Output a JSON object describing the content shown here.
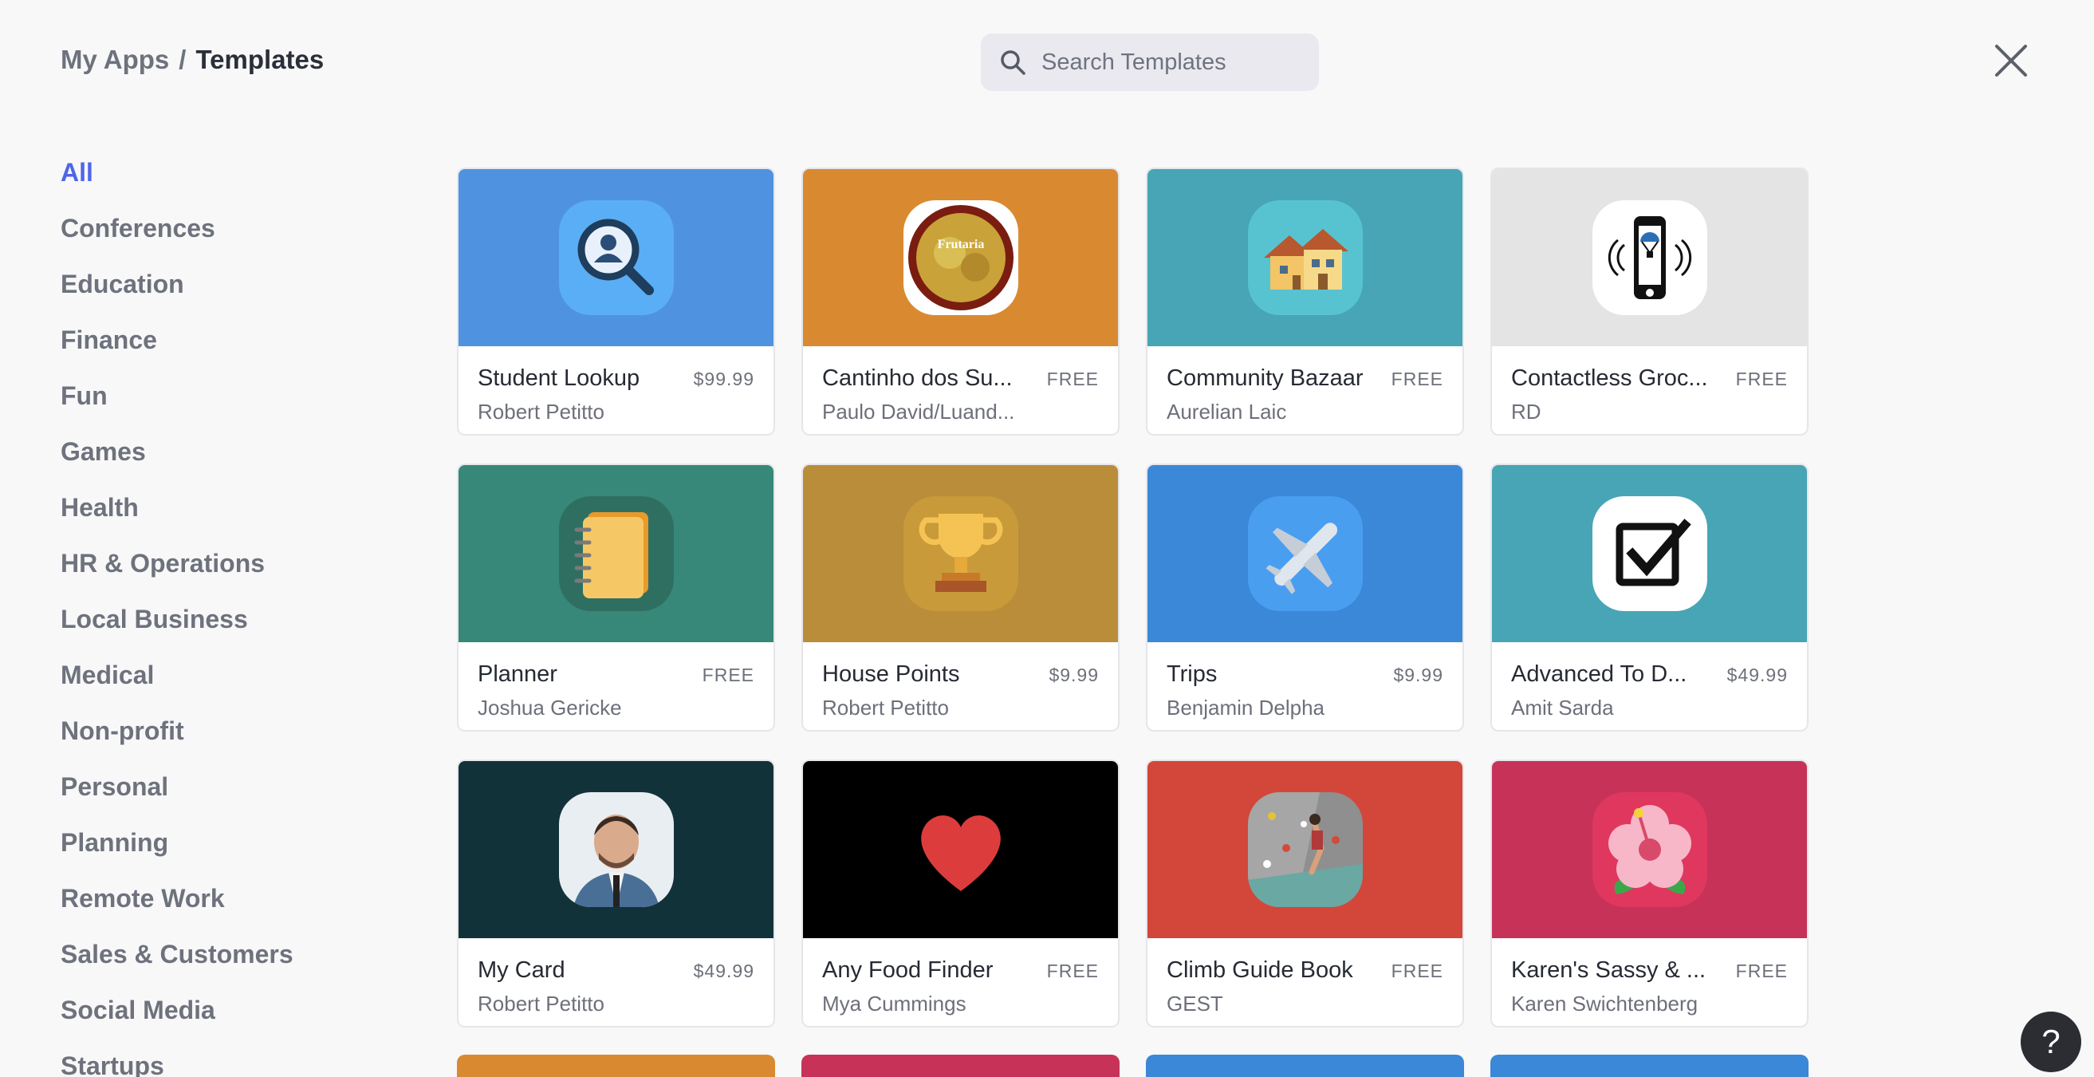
{
  "header": {
    "breadcrumb_parent": "My Apps",
    "breadcrumb_separator": "/",
    "breadcrumb_current": "Templates",
    "search_placeholder": "Search Templates"
  },
  "sidebar": {
    "active": "All",
    "categories": [
      "All",
      "Conferences",
      "Education",
      "Finance",
      "Fun",
      "Games",
      "Health",
      "HR & Operations",
      "Local Business",
      "Medical",
      "Non-profit",
      "Personal",
      "Planning",
      "Remote Work",
      "Sales & Customers",
      "Social Media",
      "Startups"
    ]
  },
  "templates": [
    {
      "title": "Student Lookup",
      "price": "$99.99",
      "author": "Robert Petitto",
      "bg": "#4f93e0",
      "icon": "student-search-icon"
    },
    {
      "title": "Cantinho dos Su...",
      "price": "FREE",
      "author": "Paulo David/Luand...",
      "bg": "#d98a31",
      "icon": "frutaria-logo-icon"
    },
    {
      "title": "Community Bazaar",
      "price": "FREE",
      "author": "Aurelian Laic",
      "bg": "#47a5b5",
      "icon": "houses-icon"
    },
    {
      "title": "Contactless Groc...",
      "price": "FREE",
      "author": "RD",
      "bg": "#e4e4e4",
      "icon": "phone-parachute-icon"
    },
    {
      "title": "Planner",
      "price": "FREE",
      "author": "Joshua Gericke",
      "bg": "#378878",
      "icon": "notebook-icon"
    },
    {
      "title": "House Points",
      "price": "$9.99",
      "author": "Robert Petitto",
      "bg": "#b98d3a",
      "icon": "trophy-icon"
    },
    {
      "title": "Trips",
      "price": "$9.99",
      "author": "Benjamin Delpha",
      "bg": "#3b87d8",
      "icon": "airplane-icon"
    },
    {
      "title": "Advanced To D...",
      "price": "$49.99",
      "author": "Amit Sarda",
      "bg": "#47a5b5",
      "icon": "checkbox-icon"
    },
    {
      "title": "My Card",
      "price": "$49.99",
      "author": "Robert Petitto",
      "bg": "#12323a",
      "icon": "profile-photo-icon"
    },
    {
      "title": "Any Food Finder",
      "price": "FREE",
      "author": "Mya Cummings",
      "bg": "#000000",
      "icon": "heart-icon"
    },
    {
      "title": "Climb Guide Book",
      "price": "FREE",
      "author": "GEST",
      "bg": "#d2473a",
      "icon": "climbing-wall-icon"
    },
    {
      "title": "Karen's Sassy & ...",
      "price": "FREE",
      "author": "Karen Swichtenberg",
      "bg": "#c63258",
      "icon": "hibiscus-icon"
    }
  ],
  "peek_colors": [
    "#d98a31",
    "#c63258",
    "#3b87d8",
    "#3b87d8"
  ],
  "help_label": "?"
}
